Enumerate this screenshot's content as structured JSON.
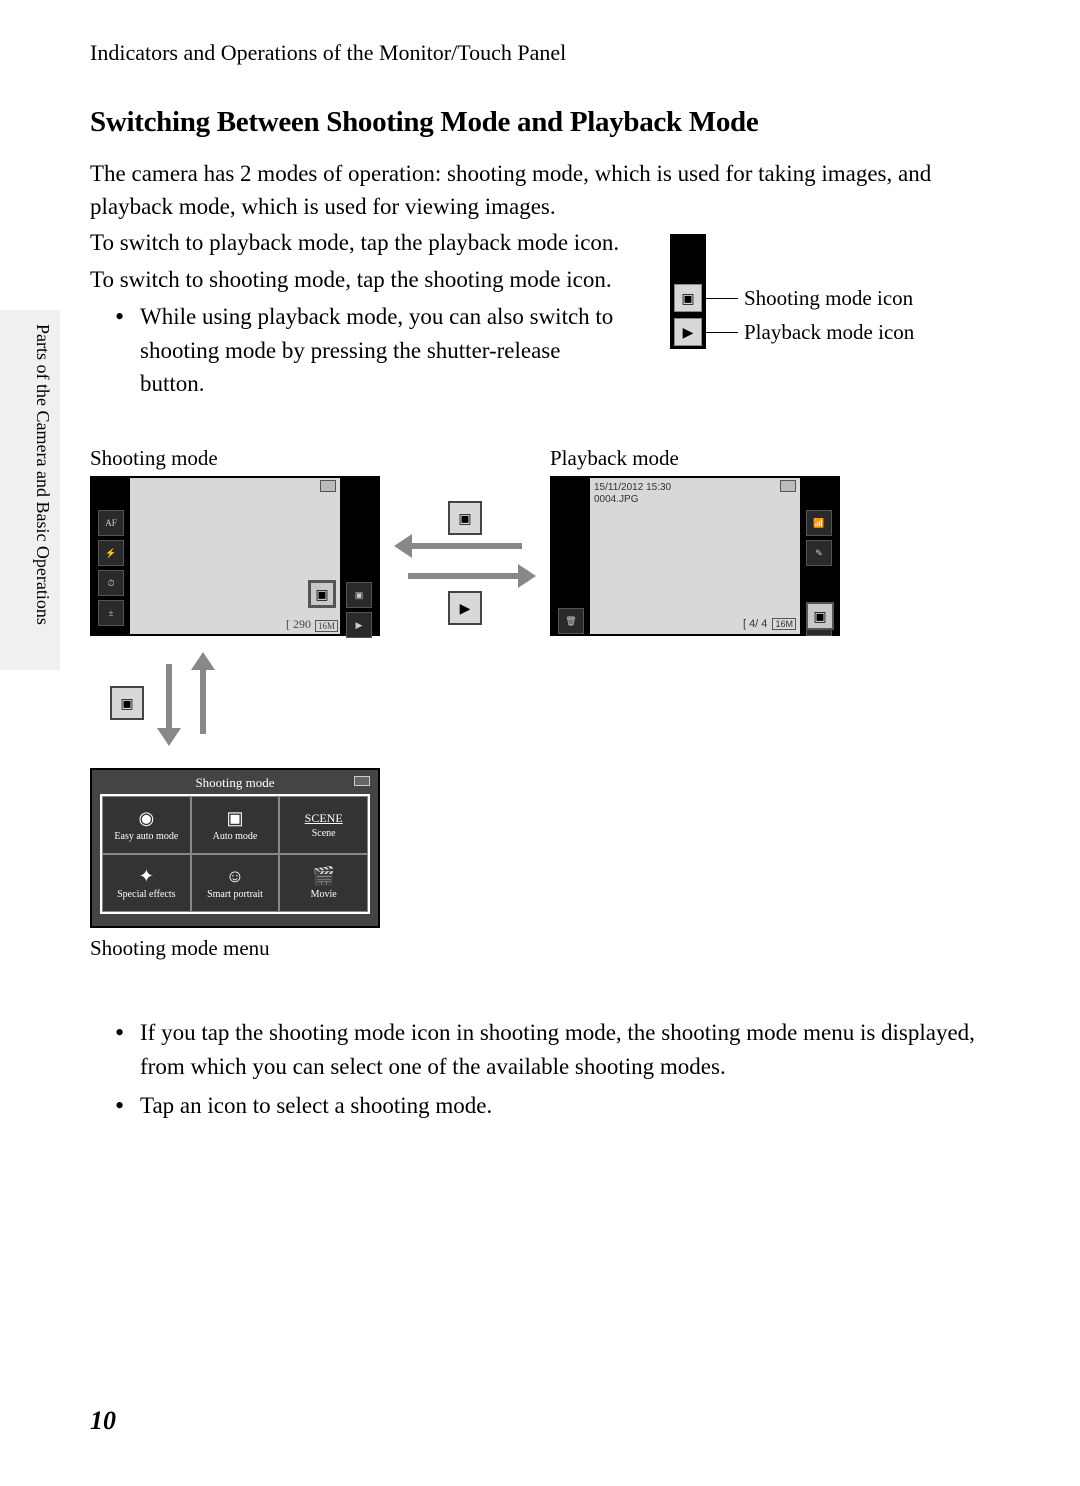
{
  "breadcrumb": "Indicators and Operations of the Monitor/Touch Panel",
  "heading": "Switching Between Shooting Mode and Playback Mode",
  "p1": "The camera has 2 modes of operation: shooting mode, which is used for taking images, and playback mode, which is used for viewing images.",
  "p2": "To switch to playback mode, tap the playback mode icon.",
  "p3": "To switch to shooting mode, tap the shooting mode icon.",
  "bullet1": "While using playback mode, you can also switch to shooting mode by pressing the shutter-release button.",
  "sidetab": "Parts of the Camera and Basic Operations",
  "callout": {
    "shooting_label": "Shooting mode icon",
    "playback_label": "Playback mode icon"
  },
  "diagram": {
    "shooting_label": "Shooting mode",
    "playback_label": "Playback mode",
    "menu_label": "Shooting mode menu",
    "shooting_screen": {
      "remaining": "290",
      "quality": "16M"
    },
    "playback_screen": {
      "date": "15/11/2012 15:30",
      "file": "0004.JPG",
      "quality": "16M",
      "count": "4/  4"
    },
    "menu": {
      "title": "Shooting mode",
      "cells": [
        "Easy auto mode",
        "Auto mode",
        "Scene",
        "Special effects",
        "Smart portrait",
        "Movie"
      ]
    }
  },
  "bullet2": "If you tap the shooting mode icon in shooting mode, the shooting mode menu is displayed, from which you can select one of the available shooting modes.",
  "bullet3": "Tap an icon to select a shooting mode.",
  "page_number": "10"
}
